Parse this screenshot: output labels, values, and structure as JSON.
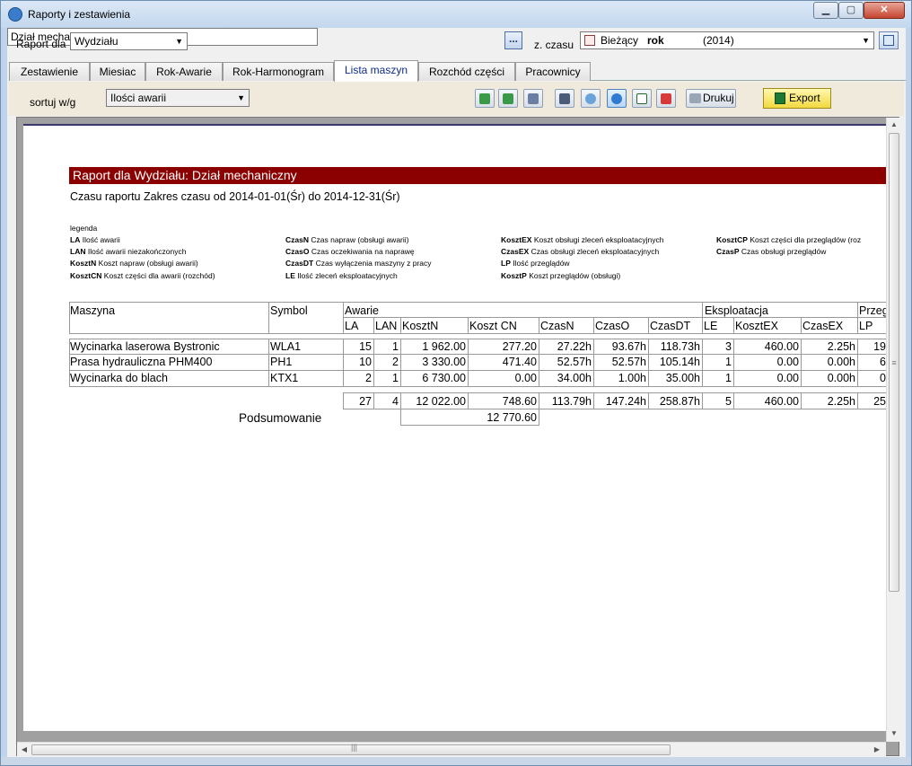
{
  "window": {
    "title": "Raporty i zestawienia"
  },
  "filter": {
    "report_for_label": "Raport dla",
    "report_for_value": "Wydziału",
    "department_value": "Dział mechaniczny",
    "browse_label": "...",
    "time_label": "z. czasu",
    "time_value_prefix": "Bieżący",
    "time_value_bold": "rok",
    "time_value_year": "(2014)"
  },
  "tabs": [
    {
      "label": "Zestawienie"
    },
    {
      "label": "Miesiac"
    },
    {
      "label": "Rok-Awarie"
    },
    {
      "label": "Rok-Harmonogram"
    },
    {
      "label": "Lista maszyn",
      "active": true
    },
    {
      "label": "Rozchód części"
    },
    {
      "label": "Pracownicy"
    }
  ],
  "toolbar": {
    "sort_label": "sortuj w/g",
    "sort_value": "Ilości awarii",
    "print_label": "Drukuj",
    "export_label": "Export",
    "icons": [
      "first-page-icon",
      "last-page-icon",
      "zoom-page-icon",
      "zoom-width-icon",
      "zoom-out-icon",
      "zoom-in-icon",
      "checkbox-icon",
      "pdf-icon"
    ]
  },
  "report": {
    "header": "Raport dla Wydziału: Dział mechaniczny",
    "subtitle": "Czasu raportu Zakres czasu od 2014-01-01(Śr) do 2014-12-31(Śr)",
    "legend_title": "legenda",
    "legend": [
      {
        "abbr": "LA",
        "desc": "Ilość awarii"
      },
      {
        "abbr": "LAN",
        "desc": "Ilość awarii niezakończonych"
      },
      {
        "abbr": "KosztN",
        "desc": "Koszt napraw (obsługi awarii)"
      },
      {
        "abbr": "KosztCN",
        "desc": "Koszt części dla awarii (rozchód)"
      },
      {
        "abbr": "CzasN",
        "desc": "Czas napraw (obsługi awarii)"
      },
      {
        "abbr": "CzasO",
        "desc": "Czas oczekiwania na naprawę"
      },
      {
        "abbr": "CzasDT",
        "desc": "Czas wyłączenia maszyny z pracy"
      },
      {
        "abbr": "LE",
        "desc": "Ilość zleceń eksploatacyjnych"
      },
      {
        "abbr": "KosztEX",
        "desc": "Koszt obsługi zleceń eksploatacyjnych"
      },
      {
        "abbr": "CzasEX",
        "desc": "Czas obsługi zleceń eksploatacyjnych"
      },
      {
        "abbr": "LP",
        "desc": "Ilość przeglądów"
      },
      {
        "abbr": "KosztP",
        "desc": "Koszt przeglądów (obsługi)"
      },
      {
        "abbr": "KosztCP",
        "desc": "Koszt części dla przeglądów (roz"
      },
      {
        "abbr": "CzasP",
        "desc": "Czas obsługi przeglądów"
      }
    ],
    "col_groups": {
      "maszyna": "Maszyna",
      "symbol": "Symbol",
      "awarie": "Awarie",
      "eksploatacja": "Eksploatacja",
      "przeglady": "Przeg"
    },
    "columns": [
      "LA",
      "LAN",
      "KosztN",
      "Koszt CN",
      "CzasN",
      "CzasO",
      "CzasDT",
      "LE",
      "KosztEX",
      "CzasEX",
      "LP"
    ],
    "rows": [
      {
        "name": "Wycinarka laserowa Bystronic",
        "symbol": "WLA1",
        "vals": [
          "15",
          "1",
          "1 962.00",
          "277.20",
          "27.22h",
          "93.67h",
          "118.73h",
          "3",
          "460.00",
          "2.25h",
          "19"
        ]
      },
      {
        "name": "Prasa hydrauliczna PHM400",
        "symbol": "PH1",
        "vals": [
          "10",
          "2",
          "3 330.00",
          "471.40",
          "52.57h",
          "52.57h",
          "105.14h",
          "1",
          "0.00",
          "0.00h",
          "6"
        ]
      },
      {
        "name": "Wycinarka do blach",
        "symbol": "KTX1",
        "vals": [
          "2",
          "1",
          "6 730.00",
          "0.00",
          "34.00h",
          "1.00h",
          "35.00h",
          "1",
          "0.00",
          "0.00h",
          "0"
        ]
      }
    ],
    "totals": [
      "27",
      "4",
      "12 022.00",
      "748.60",
      "113.79h",
      "147.24h",
      "258.87h",
      "5",
      "460.00",
      "2.25h",
      "25"
    ],
    "summary_label": "Podsumowanie",
    "summary_value": "12 770.60"
  }
}
